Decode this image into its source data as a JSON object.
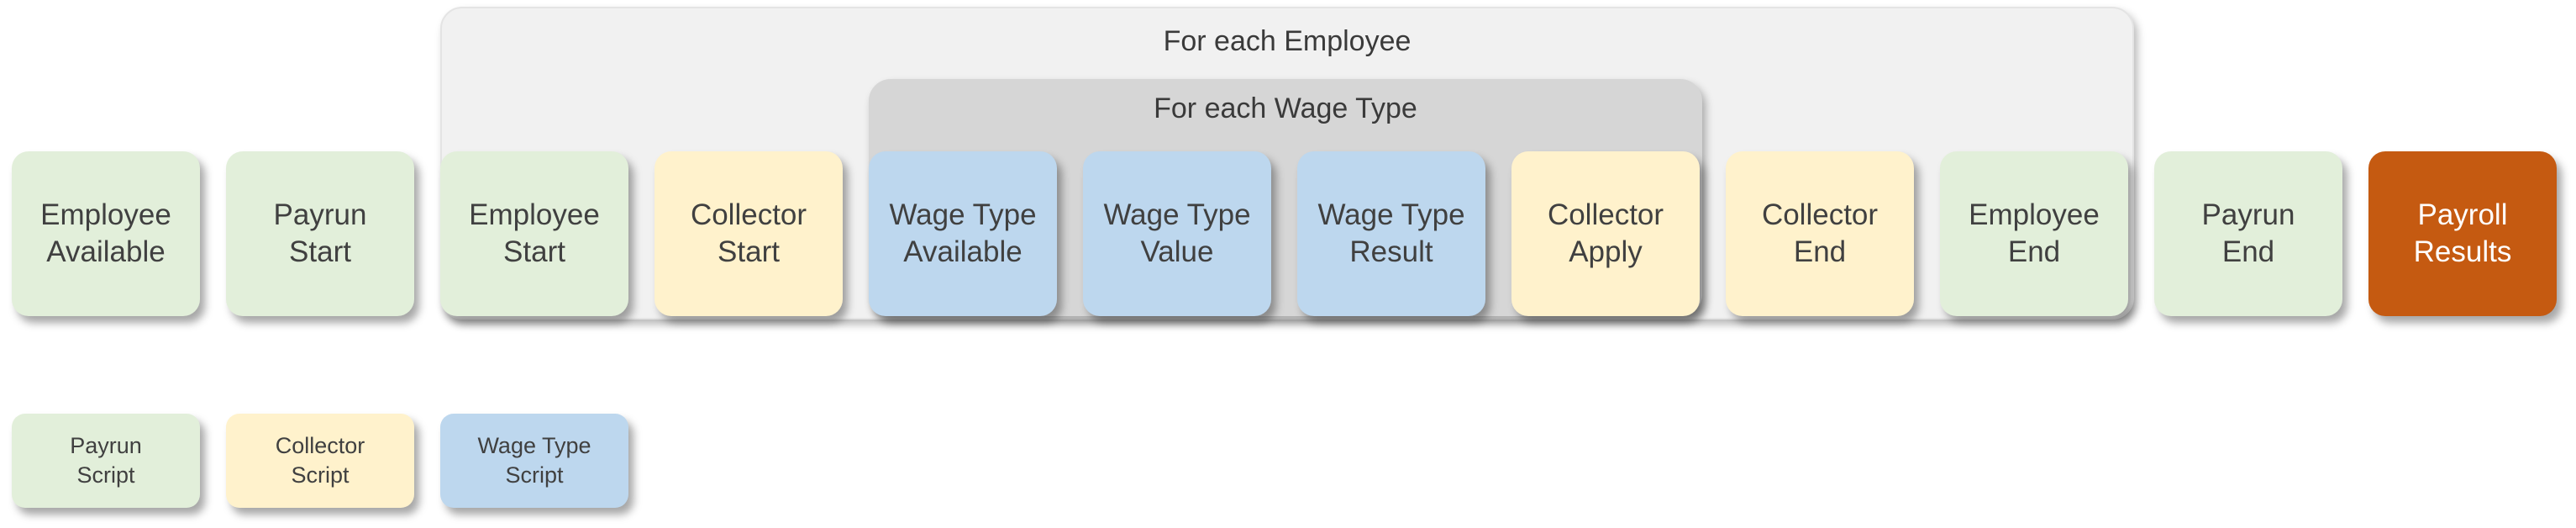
{
  "groups": {
    "employee_loop": "For each Employee",
    "wage_type_loop": "For each Wage Type"
  },
  "steps": [
    {
      "label": "Employee\nAvailable",
      "kind": "payrun",
      "color": "#e2efda"
    },
    {
      "label": "Payrun\nStart",
      "kind": "payrun",
      "color": "#e2efda"
    },
    {
      "label": "Employee\nStart",
      "kind": "payrun",
      "color": "#e2efda"
    },
    {
      "label": "Collector\nStart",
      "kind": "collector",
      "color": "#fff2cc"
    },
    {
      "label": "Wage Type\nAvailable",
      "kind": "wage_type",
      "color": "#bdd7ee"
    },
    {
      "label": "Wage Type\nValue",
      "kind": "wage_type",
      "color": "#bdd7ee"
    },
    {
      "label": "Wage Type\nResult",
      "kind": "wage_type",
      "color": "#bdd7ee"
    },
    {
      "label": "Collector\nApply",
      "kind": "collector",
      "color": "#fff2cc"
    },
    {
      "label": "Collector\nEnd",
      "kind": "collector",
      "color": "#fff2cc"
    },
    {
      "label": "Employee\nEnd",
      "kind": "payrun",
      "color": "#e2efda"
    },
    {
      "label": "Payrun\nEnd",
      "kind": "payrun",
      "color": "#e2efda"
    },
    {
      "label": "Payroll\nResults",
      "kind": "result",
      "color": "#c55a11"
    }
  ],
  "legend": [
    {
      "label": "Payrun\nScript",
      "color": "#e2efda"
    },
    {
      "label": "Collector\nScript",
      "color": "#fff2cc"
    },
    {
      "label": "Wage Type\nScript",
      "color": "#bdd7ee"
    }
  ]
}
